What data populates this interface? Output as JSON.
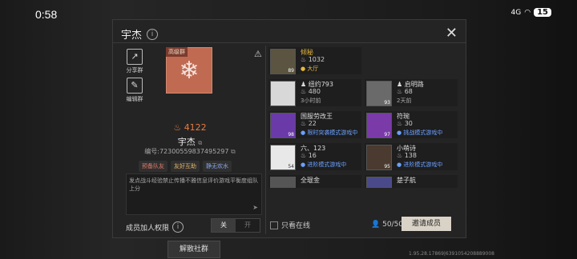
{
  "status_bar": {
    "time": "0:58",
    "network": "4G",
    "battery": "15"
  },
  "dialog": {
    "title": "宇杰",
    "close_label": "✕",
    "side_buttons": [
      {
        "label": "分享群"
      },
      {
        "label": "编辑群"
      }
    ],
    "group": {
      "grade_badge": "高级群",
      "heat": "4122",
      "name": "宇杰",
      "id_text": "编号:72300559837495297",
      "tags": [
        "预备队友",
        "友好互助",
        "静无欢水"
      ],
      "description": "发点战斗经验禁止传播不雅信息评价游戏平衡度组队上分",
      "permission_label": "成员加人权限",
      "toggle": {
        "on": "关",
        "off": "开"
      },
      "disband_label": "解散社群"
    },
    "members": [
      {
        "name": "倾秘",
        "heat": "1032",
        "status": "大厅",
        "status_type": "online",
        "level": "89"
      },
      {
        "name": "纽约793",
        "heat": "480",
        "status": "3小时前",
        "status_type": "offline",
        "level": ""
      },
      {
        "name": "启明路",
        "heat": "68",
        "status": "2天前",
        "status_type": "offline",
        "level": "93"
      },
      {
        "name": "国服劳改王",
        "heat": "22",
        "status": "限时突袭模式游戏中",
        "status_type": "game",
        "level": "98"
      },
      {
        "name": "符琬",
        "heat": "30",
        "status": "挑战模式游戏中",
        "status_type": "game",
        "level": "97"
      },
      {
        "name": "六、123",
        "heat": "16",
        "status": "进阶模式游戏中",
        "status_type": "game",
        "level": "54"
      },
      {
        "name": "小萌诗",
        "heat": "138",
        "status": "进阶模式游戏中",
        "status_type": "game",
        "level": "95"
      },
      {
        "name": "全琨金",
        "heat": "",
        "status": "",
        "status_type": "offline",
        "level": ""
      },
      {
        "name": "楚子航",
        "heat": "",
        "status": "",
        "status_type": "offline",
        "level": ""
      }
    ],
    "online_only_label": "只看在线",
    "member_count": "50/50",
    "invite_label": "邀请成员"
  },
  "footer": {
    "version": "1.95.28.17869|6391054208889008"
  }
}
